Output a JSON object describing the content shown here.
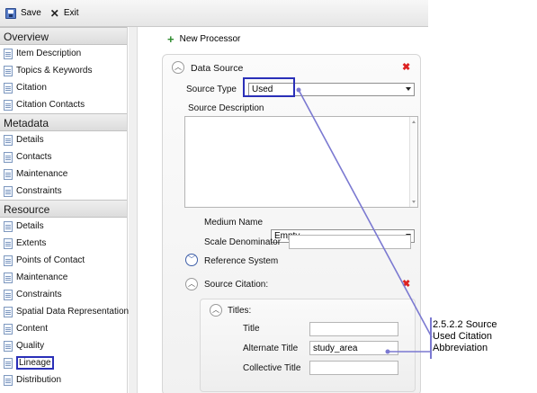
{
  "toolbar": {
    "save_label": "Save",
    "exit_label": "Exit"
  },
  "sidebar": {
    "sections": [
      {
        "title": "Overview",
        "items": [
          "Item Description",
          "Topics & Keywords",
          "Citation",
          "Citation Contacts"
        ]
      },
      {
        "title": "Metadata",
        "items": [
          "Details",
          "Contacts",
          "Maintenance",
          "Constraints"
        ]
      },
      {
        "title": "Resource",
        "items": [
          "Details",
          "Extents",
          "Points of Contact",
          "Maintenance",
          "Constraints",
          "Spatial Data Representation",
          "Content",
          "Quality",
          "Lineage",
          "Distribution"
        ]
      }
    ],
    "selected_item": "Lineage"
  },
  "content": {
    "new_processor_label": "New Processor",
    "data_source": {
      "title": "Data Source",
      "source_type_label": "Source Type",
      "source_type_value": "Used",
      "source_description_label": "Source Description",
      "source_description_value": "",
      "medium_name_label": "Medium Name",
      "medium_name_value": "Empty",
      "scale_denominator_label": "Scale Denominator",
      "scale_denominator_value": "",
      "reference_system_label": "Reference System",
      "source_citation_label": "Source Citation:",
      "titles": {
        "header": "Titles:",
        "title_label": "Title",
        "title_value": "",
        "alternate_title_label": "Alternate Title",
        "alternate_title_value": "study_area",
        "collective_title_label": "Collective Title",
        "collective_title_value": ""
      }
    }
  },
  "annotation": {
    "line1": "2.5.2.2 Source",
    "line2": "Used Citation",
    "line3": "Abbreviation",
    "color": "#7b79d1",
    "box_color": "#2a2fb8"
  }
}
